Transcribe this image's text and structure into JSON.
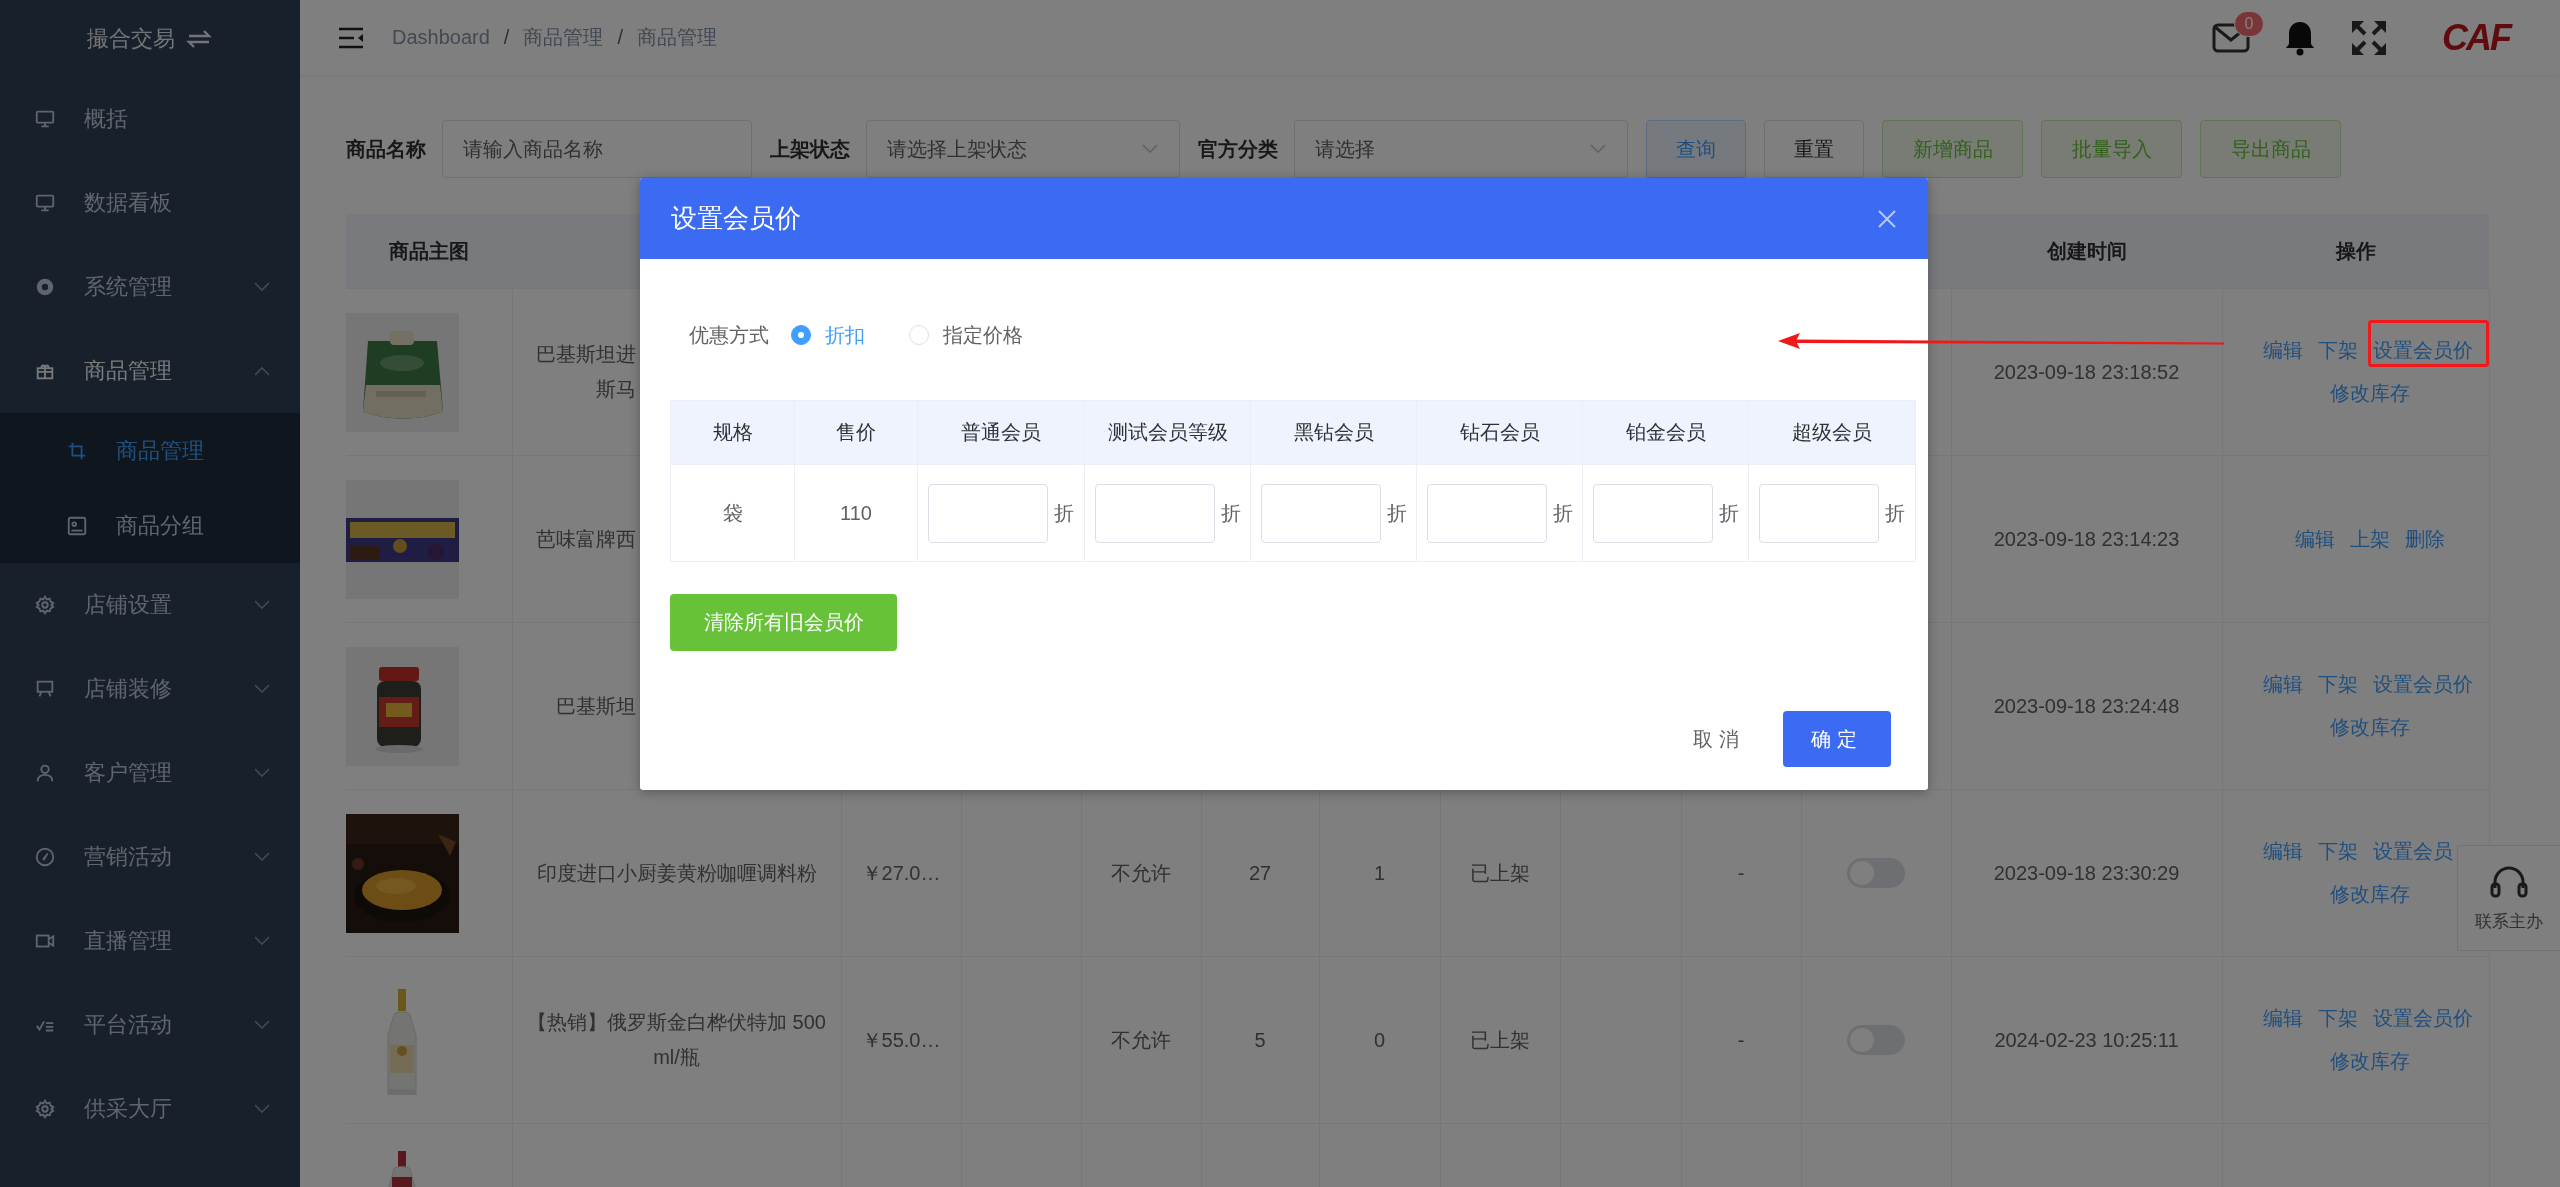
{
  "sidebar": {
    "title": "撮合交易",
    "items": [
      {
        "label": "概括",
        "kind": "link"
      },
      {
        "label": "数据看板",
        "kind": "link"
      },
      {
        "label": "系统管理",
        "kind": "submenu",
        "expanded": false
      },
      {
        "label": "商品管理",
        "kind": "submenu",
        "expanded": true,
        "children": [
          {
            "label": "商品管理",
            "selected": true
          },
          {
            "label": "商品分组",
            "selected": false
          }
        ]
      },
      {
        "label": "店铺设置",
        "kind": "submenu",
        "expanded": false
      },
      {
        "label": "店铺装修",
        "kind": "submenu",
        "expanded": false
      },
      {
        "label": "客户管理",
        "kind": "submenu",
        "expanded": false
      },
      {
        "label": "营销活动",
        "kind": "submenu",
        "expanded": false
      },
      {
        "label": "直播管理",
        "kind": "submenu",
        "expanded": false
      },
      {
        "label": "平台活动",
        "kind": "submenu",
        "expanded": false
      },
      {
        "label": "供采大厅",
        "kind": "submenu",
        "expanded": false
      }
    ]
  },
  "header": {
    "breadcrumb": [
      {
        "label": "Dashboard"
      },
      {
        "label": "商品管理"
      },
      {
        "label": "商品管理"
      }
    ],
    "separator": "/",
    "message_count": "0",
    "logo_text": "CAF"
  },
  "filters": [
    {
      "label": "商品名称",
      "kind": "input",
      "placeholder": "请输入商品名称"
    },
    {
      "label": "上架状态",
      "kind": "select",
      "placeholder": "请选择上架状态"
    },
    {
      "label": "官方分类",
      "kind": "select",
      "placeholder": "请选择"
    }
  ],
  "toolbar_buttons": [
    {
      "label": "查询",
      "kind": "primary"
    },
    {
      "label": "重置",
      "kind": "default"
    },
    {
      "label": "新增商品",
      "kind": "success"
    },
    {
      "label": "批量导入",
      "kind": "success"
    },
    {
      "label": "导出商品",
      "kind": "success"
    }
  ],
  "table": {
    "columns": [
      {
        "label": "商品主图"
      },
      {},
      {},
      {},
      {},
      {},
      {},
      {},
      {},
      {},
      {},
      {
        "label": "创建时间"
      },
      {
        "label": "操作"
      }
    ],
    "rows": [
      {
        "name_lines": [
          "巴基斯坦进",
          "斯马"
        ],
        "created": "2023-09-18 23:18:52",
        "action_lines": [
          [
            {
              "label": "编辑"
            },
            {
              "label": "下架"
            },
            {
              "label": "设置会员价"
            }
          ],
          [
            {
              "label": "修改库存"
            }
          ]
        ]
      },
      {
        "name_lines": [
          "芭味富牌西"
        ],
        "created": "2023-09-18 23:14:23",
        "action_lines": [
          [
            {
              "label": "编辑"
            },
            {
              "label": "上架"
            },
            {
              "label": "删除"
            }
          ]
        ]
      },
      {
        "name_lines": [
          "巴基斯坦"
        ],
        "created": "2023-09-18 23:24:48",
        "action_lines": [
          [
            {
              "label": "编辑"
            },
            {
              "label": "下架"
            },
            {
              "label": "设置会员价"
            }
          ],
          [
            {
              "label": "修改库存"
            }
          ]
        ]
      },
      {
        "name": "印度进口小厨姜黄粉咖喱调料粉",
        "price": "￥27.0…",
        "column_5": "不允许",
        "column_6": "27",
        "column_7": "1",
        "column_8": "已上架",
        "column_10": "-",
        "listed_switch": {
          "on": false
        },
        "created": "2023-09-18 23:30:29",
        "action_lines": [
          [
            {
              "label": "编辑"
            },
            {
              "label": "下架"
            },
            {
              "label": "设置会员"
            }
          ],
          [
            {
              "label": "修改库存"
            }
          ]
        ]
      },
      {
        "name": "【热销】俄罗斯金白桦伏特加 500ml/瓶",
        "price": "￥55.0…",
        "column_5": "不允许",
        "column_6": "5",
        "column_7": "0",
        "column_8": "已上架",
        "column_10": "-",
        "listed_switch": {
          "on": false
        },
        "created": "2024-02-23 10:25:11",
        "action_lines": [
          [
            {
              "label": "编辑"
            },
            {
              "label": "下架"
            },
            {
              "label": "设置会员价"
            }
          ],
          [
            {
              "label": "修改库存"
            }
          ]
        ]
      },
      {}
    ]
  },
  "contact_widget": {
    "label": "联系主办"
  },
  "dialog": {
    "title": "设置会员价",
    "mode_label": "优惠方式",
    "options": [
      {
        "label": "折扣",
        "selected": true
      },
      {
        "label": "指定价格",
        "selected": false
      }
    ],
    "columns": [
      "规格",
      "售价",
      "普通会员",
      "测试会员等级",
      "黑钻会员",
      "钻石会员",
      "铂金会员",
      "超级会员"
    ],
    "rows": [
      {
        "spec": "袋",
        "price": "110",
        "inputs": [
          {
            "suffix": "折"
          },
          {
            "suffix": "折"
          },
          {
            "suffix": "折"
          },
          {
            "suffix": "折"
          },
          {
            "suffix": "折"
          },
          {
            "suffix": "折"
          }
        ]
      }
    ],
    "clear_button": "清除所有旧会员价",
    "cancel": "取消",
    "confirm": "确定"
  }
}
